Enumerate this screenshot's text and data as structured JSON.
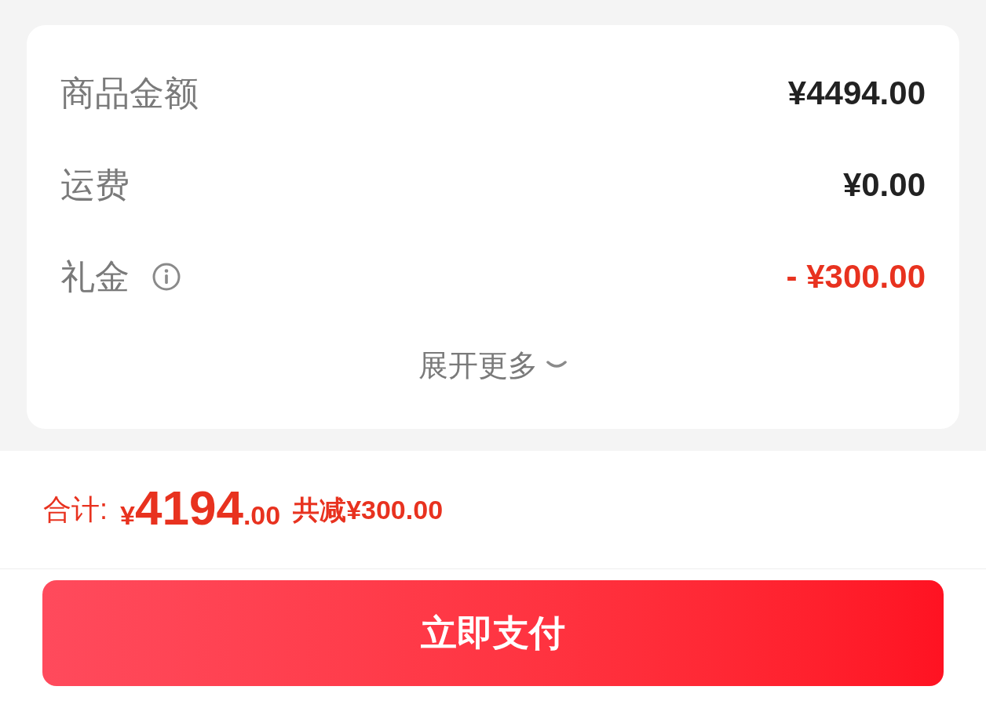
{
  "summary": {
    "rows": [
      {
        "label": "商品金额",
        "value": "¥4494.00",
        "kind": "plain"
      },
      {
        "label": "运费",
        "value": "¥0.00",
        "kind": "plain"
      },
      {
        "label": "礼金",
        "value": "- ¥300.00",
        "kind": "discount"
      }
    ],
    "expand": {
      "label": "展开更多",
      "expanded": false
    }
  },
  "total": {
    "label": "合计:",
    "currency": "¥",
    "integer": "4194",
    "decimal": ".00",
    "saving": "共减¥300.00"
  },
  "pay_button": "立即支付"
}
